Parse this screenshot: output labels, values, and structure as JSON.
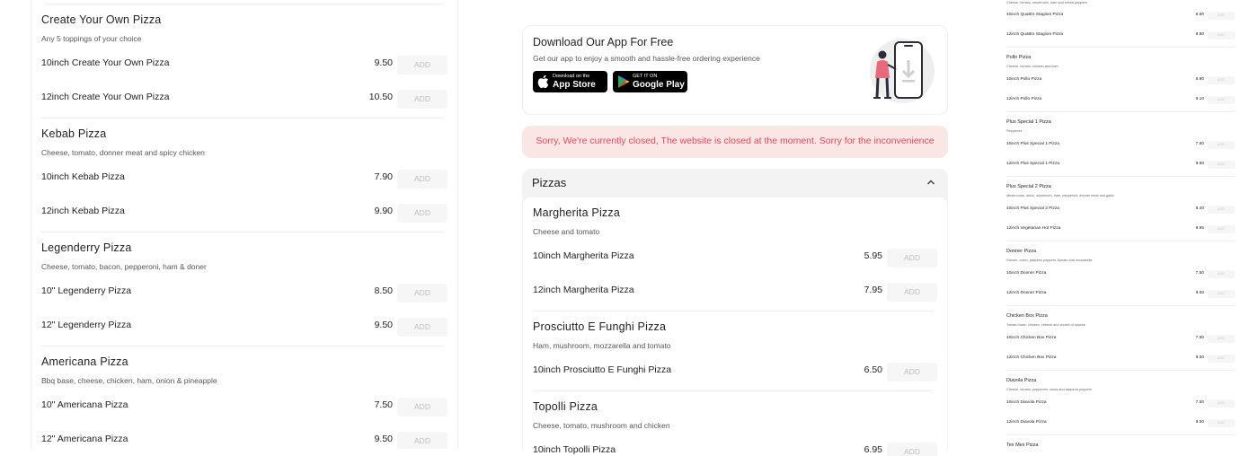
{
  "left_menu": [
    {
      "title": "Create Your Own Pizza",
      "desc": "Any 5 toppings of your choice",
      "items": [
        {
          "name": "10inch Create Your Own Pizza",
          "price": "9.50"
        },
        {
          "name": "12inch Create Your Own Pizza",
          "price": "10.50"
        }
      ]
    },
    {
      "title": "Kebab Pizza",
      "desc": "Cheese, tomato, donner meat and spicy chicken",
      "items": [
        {
          "name": "10inch Kebab Pizza",
          "price": "7.90"
        },
        {
          "name": "12inch Kebab Pizza",
          "price": "9.90"
        }
      ]
    },
    {
      "title": "Legenderry Pizza",
      "desc": "Cheese, tomato, bacon, pepperoni, ham & doner",
      "items": [
        {
          "name": "10\" Legenderry Pizza",
          "price": "8.50"
        },
        {
          "name": "12\" Legenderry Pizza",
          "price": "9.50"
        }
      ]
    },
    {
      "title": "Americana Pizza",
      "desc": "Bbq base, cheese, chicken, ham, onion & pineapple",
      "items": [
        {
          "name": "10\" Americana Pizza",
          "price": "7.50"
        },
        {
          "name": "12\" Americana Pizza",
          "price": "9.50"
        }
      ]
    }
  ],
  "add_label": "ADD",
  "app_promo": {
    "title": "Download Our App For Free",
    "subtitle": "Get our app to enjoy a smooth and hassle-free ordering experience",
    "appstore_small": "Download on the",
    "appstore_big": "App Store",
    "googleplay_small": "GET IT ON",
    "googleplay_big": "Google Play"
  },
  "closed_notice": "Sorry, We're currently closed, The website is closed at the moment. Sorry for the inconvenience",
  "category": {
    "title": "Pizzas",
    "sections": [
      {
        "title": "Margherita Pizza",
        "desc": "Cheese and tomato",
        "items": [
          {
            "name": "10inch Margherita Pizza",
            "price": "5.95"
          },
          {
            "name": "12inch Margherita Pizza",
            "price": "7.95"
          }
        ]
      },
      {
        "title": "Prosciutto E Funghi Pizza",
        "desc": "Ham, mushroom, mozzarella and tomato",
        "items": [
          {
            "name": "10inch Prosciutto E Funghi Pizza",
            "price": "6.50"
          }
        ]
      },
      {
        "title": "Topolli Pizza",
        "desc": "Cheese, tomato, mushroom and chicken",
        "items": [
          {
            "name": "10inch Topolli Pizza",
            "price": "6.95"
          }
        ]
      }
    ]
  },
  "mini_menu": {
    "top_desc": "Cheese, tomato, mushroom, ham and mixed peppers",
    "top_items": [
      {
        "name": "10inch Quattro Stagioni Pizza",
        "price": "6.60"
      },
      {
        "name": "12inch Quattro Stagioni Pizza",
        "price": "8.90"
      }
    ],
    "sections": [
      {
        "title": "Pollo Pizza",
        "desc": "Cheese, tomato, chicken and ham",
        "items": [
          {
            "name": "10inch Pollo Pizza",
            "price": "6.90"
          },
          {
            "name": "12inch Pollo Pizza",
            "price": "9.10"
          }
        ]
      },
      {
        "title": "Plus Special 1 Pizza",
        "desc": "Pepperoni",
        "items": [
          {
            "name": "10inch Plus Special 1 Pizza",
            "price": "7.50"
          },
          {
            "name": "12inch Plus Special 1 Pizza",
            "price": "9.60"
          }
        ]
      },
      {
        "title": "Plus Special 2 Pizza",
        "desc": "Mushrooms, onion, sweetcorn, ham, pepperoni, donner meat and garlic",
        "items": [
          {
            "name": "10inch Plus Special 2 Pizza",
            "price": "8.40"
          },
          {
            "name": "12inch Vegetarian Hot Pizza",
            "price": "8.95"
          }
        ]
      },
      {
        "title": "Donner Pizza",
        "desc": "Donner, onion, jalapeno peppers, tomato and mozzarella",
        "items": [
          {
            "name": "10inch Donner Pizza",
            "price": "7.50"
          },
          {
            "name": "12inch Donner Pizza",
            "price": "9.50"
          }
        ]
      },
      {
        "title": "Chicken Box Pizza",
        "desc": "Tomato base, chicken, cheese and choice of sauces",
        "items": [
          {
            "name": "10inch Chicken Box Pizza",
            "price": "7.50"
          },
          {
            "name": "12inch Chicken Box Pizza",
            "price": "9.50"
          }
        ]
      },
      {
        "title": "Diavola Pizza",
        "desc": "Cheese, tomato, pepperoni, onion and jalapeno peppers",
        "items": [
          {
            "name": "10inch Diavola Pizza",
            "price": "7.50"
          },
          {
            "name": "12inch Diavola Pizza",
            "price": "9.50"
          }
        ]
      },
      {
        "title": "Tex Mex Pizza",
        "desc": "",
        "items": []
      }
    ]
  },
  "colors": {
    "closed_bg": "#fbe6e6",
    "closed_text": "#e0485a",
    "add_bg": "#f6f6f6",
    "add_text": "#bdbdbd"
  }
}
